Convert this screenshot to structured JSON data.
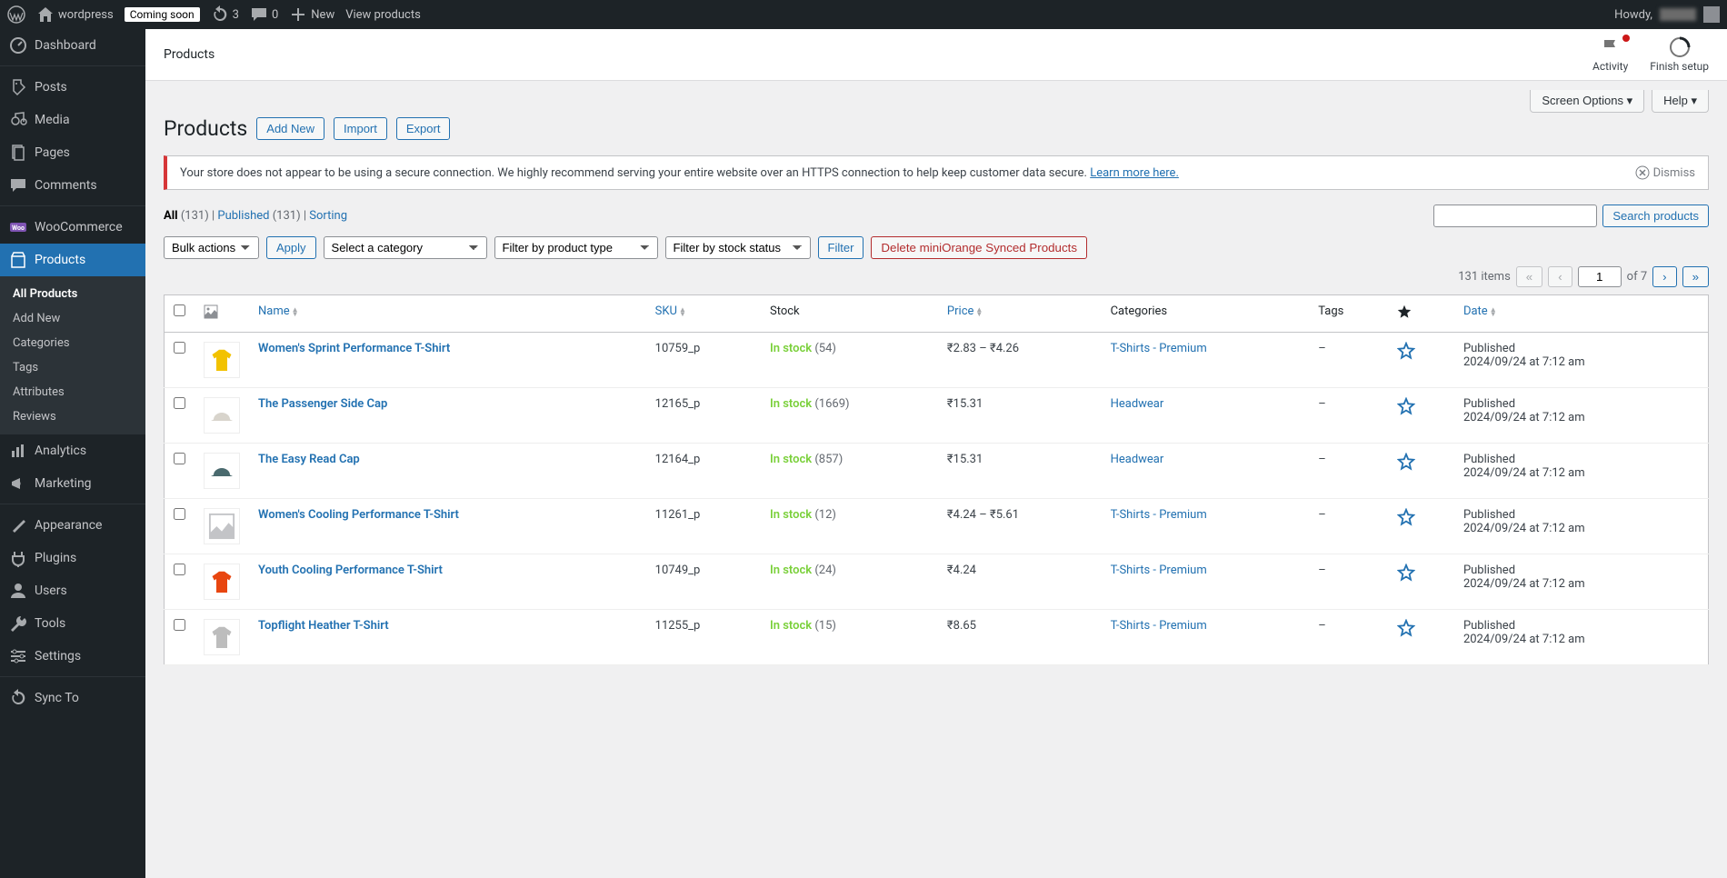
{
  "adminbar": {
    "site": "wordpress",
    "coming_soon": "Coming soon",
    "updates": "3",
    "comments": "0",
    "new": "New",
    "view_products": "View products",
    "howdy": "Howdy,"
  },
  "sidebar": {
    "dashboard": "Dashboard",
    "posts": "Posts",
    "media": "Media",
    "pages": "Pages",
    "comments": "Comments",
    "woocommerce": "WooCommerce",
    "products": "Products",
    "analytics": "Analytics",
    "marketing": "Marketing",
    "appearance": "Appearance",
    "plugins": "Plugins",
    "users": "Users",
    "tools": "Tools",
    "settings": "Settings",
    "sync": "Sync To",
    "submenu": {
      "all": "All Products",
      "add": "Add New",
      "categories": "Categories",
      "tags": "Tags",
      "attributes": "Attributes",
      "reviews": "Reviews"
    }
  },
  "header": {
    "title": "Products",
    "activity": "Activity",
    "finish": "Finish setup"
  },
  "screen": {
    "options": "Screen Options",
    "help": "Help"
  },
  "page": {
    "title": "Products",
    "add_new": "Add New",
    "import": "Import",
    "export": "Export"
  },
  "notice": {
    "text": "Your store does not appear to be using a secure connection. We highly recommend serving your entire website over an HTTPS connection to help keep customer data secure. ",
    "link": "Learn more here.",
    "dismiss": "Dismiss"
  },
  "views": {
    "all": "All",
    "all_count": "(131)",
    "sep": " | ",
    "published": "Published",
    "published_count": "(131)",
    "sorting": "Sorting"
  },
  "search": {
    "button": "Search products"
  },
  "filters": {
    "bulk": "Bulk actions",
    "apply": "Apply",
    "category": "Select a category",
    "type": "Filter by product type",
    "stock": "Filter by stock status",
    "filter": "Filter",
    "delete_synced": "Delete miniOrange Synced Products"
  },
  "pagination": {
    "items": "131 items",
    "page": "1",
    "of": "of 7"
  },
  "columns": {
    "name": "Name",
    "sku": "SKU",
    "stock": "Stock",
    "price": "Price",
    "categories": "Categories",
    "tags": "Tags",
    "date": "Date"
  },
  "rows": [
    {
      "name": "Women's Sprint Performance T-Shirt",
      "sku": "10759_p",
      "stock": "In stock",
      "count": "(54)",
      "price": "₹2.83 – ₹4.26",
      "cat": "T-Shirts - Premium",
      "tags": "–",
      "date1": "Published",
      "date2": "2024/09/24 at 7:12 am",
      "color": "#f2c200"
    },
    {
      "name": "The Passenger Side Cap",
      "sku": "12165_p",
      "stock": "In stock",
      "count": "(1669)",
      "price": "₹15.31",
      "cat": "Headwear",
      "tags": "–",
      "date1": "Published",
      "date2": "2024/09/24 at 7:12 am",
      "color": "#d8d4cc"
    },
    {
      "name": "The Easy Read Cap",
      "sku": "12164_p",
      "stock": "In stock",
      "count": "(857)",
      "price": "₹15.31",
      "cat": "Headwear",
      "tags": "–",
      "date1": "Published",
      "date2": "2024/09/24 at 7:12 am",
      "color": "#4a6a6e"
    },
    {
      "name": "Women's Cooling Performance T-Shirt",
      "sku": "11261_p",
      "stock": "In stock",
      "count": "(12)",
      "price": "₹4.24 – ₹5.61",
      "cat": "T-Shirts - Premium",
      "tags": "–",
      "date1": "Published",
      "date2": "2024/09/24 at 7:12 am",
      "color": "placeholder"
    },
    {
      "name": "Youth Cooling Performance T-Shirt",
      "sku": "10749_p",
      "stock": "In stock",
      "count": "(24)",
      "price": "₹4.24",
      "cat": "T-Shirts - Premium",
      "tags": "–",
      "date1": "Published",
      "date2": "2024/09/24 at 7:12 am",
      "color": "#e84610"
    },
    {
      "name": "Topflight Heather T-Shirt",
      "sku": "11255_p",
      "stock": "In stock",
      "count": "(15)",
      "price": "₹8.65",
      "cat": "T-Shirts - Premium",
      "tags": "–",
      "date1": "Published",
      "date2": "2024/09/24 at 7:12 am",
      "color": "#bdbdbd"
    }
  ]
}
